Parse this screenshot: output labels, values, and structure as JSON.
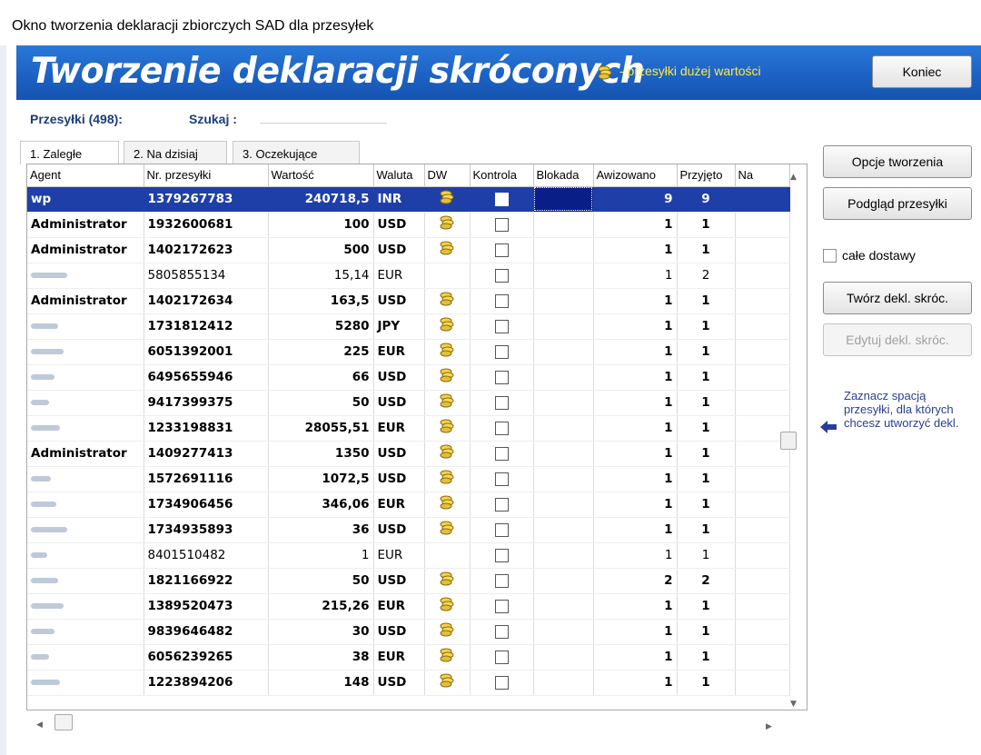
{
  "window": {
    "title": "Okno tworzenia deklaracji zbiorczych SAD dla przesyłek"
  },
  "banner": {
    "title": "Tworzenie deklaracji skróconych",
    "legend_icon": "coins-icon",
    "legend_text": "- przesyłki dużej wartości",
    "color": "#1c62c4",
    "legend_color": "#ffe94a"
  },
  "buttons": {
    "koniec": "Koniec",
    "opcje": "Opcje tworzenia",
    "podglad": "Podgląd przesyłki",
    "tworz": "Twórz dekl. skróc.",
    "edytuj": "Edytuj dekl. skróc."
  },
  "summary": {
    "count_label": "Przesyłki (498):",
    "search_label": "Szukaj :",
    "search_value": ""
  },
  "tabs": [
    {
      "label": "1. Zaległe",
      "active": true
    },
    {
      "label": "2. Na dzisiaj",
      "active": false
    },
    {
      "label": "3. Oczekujące",
      "active": false
    }
  ],
  "table": {
    "columns": [
      "Agent",
      "Nr. przesyłki",
      "Wartość",
      "Waluta",
      "DW",
      "Kontrola",
      "Blokada",
      "Awizowano",
      "Przyjęto",
      "Na"
    ],
    "rows": [
      {
        "agent": "wp",
        "nr": "1379267783",
        "wartosc": "240718,5",
        "waluta": "INR",
        "dw": true,
        "aw": "9",
        "prz": "9",
        "bold": true,
        "selected": true
      },
      {
        "agent": "Administrator",
        "nr": "1932600681",
        "wartosc": "100",
        "waluta": "USD",
        "dw": true,
        "aw": "1",
        "prz": "1",
        "bold": true
      },
      {
        "agent": "Administrator",
        "nr": "1402172623",
        "wartosc": "500",
        "waluta": "USD",
        "dw": true,
        "aw": "1",
        "prz": "1",
        "bold": true
      },
      {
        "agent": "",
        "nr": "5805855134",
        "wartosc": "15,14",
        "waluta": "EUR",
        "dw": false,
        "aw": "1",
        "prz": "2",
        "bold": false
      },
      {
        "agent": "Administrator",
        "nr": "1402172634",
        "wartosc": "163,5",
        "waluta": "USD",
        "dw": true,
        "aw": "1",
        "prz": "1",
        "bold": true
      },
      {
        "agent": "",
        "nr": "1731812412",
        "wartosc": "5280",
        "waluta": "JPY",
        "dw": true,
        "aw": "1",
        "prz": "1",
        "bold": true
      },
      {
        "agent": "",
        "nr": "6051392001",
        "wartosc": "225",
        "waluta": "EUR",
        "dw": true,
        "aw": "1",
        "prz": "1",
        "bold": true
      },
      {
        "agent": "",
        "nr": "6495655946",
        "wartosc": "66",
        "waluta": "USD",
        "dw": true,
        "aw": "1",
        "prz": "1",
        "bold": true
      },
      {
        "agent": "",
        "nr": "9417399375",
        "wartosc": "50",
        "waluta": "USD",
        "dw": true,
        "aw": "1",
        "prz": "1",
        "bold": true
      },
      {
        "agent": "",
        "nr": "1233198831",
        "wartosc": "28055,51",
        "waluta": "EUR",
        "dw": true,
        "aw": "1",
        "prz": "1",
        "bold": true
      },
      {
        "agent": "Administrator",
        "nr": "1409277413",
        "wartosc": "1350",
        "waluta": "USD",
        "dw": true,
        "aw": "1",
        "prz": "1",
        "bold": true
      },
      {
        "agent": "",
        "nr": "1572691116",
        "wartosc": "1072,5",
        "waluta": "USD",
        "dw": true,
        "aw": "1",
        "prz": "1",
        "bold": true
      },
      {
        "agent": "",
        "nr": "1734906456",
        "wartosc": "346,06",
        "waluta": "EUR",
        "dw": true,
        "aw": "1",
        "prz": "1",
        "bold": true
      },
      {
        "agent": "",
        "nr": "1734935893",
        "wartosc": "36",
        "waluta": "USD",
        "dw": true,
        "aw": "1",
        "prz": "1",
        "bold": true
      },
      {
        "agent": "",
        "nr": "8401510482",
        "wartosc": "1",
        "waluta": "EUR",
        "dw": false,
        "aw": "1",
        "prz": "1",
        "bold": false
      },
      {
        "agent": "",
        "nr": "1821166922",
        "wartosc": "50",
        "waluta": "USD",
        "dw": true,
        "aw": "2",
        "prz": "2",
        "bold": true
      },
      {
        "agent": "",
        "nr": "1389520473",
        "wartosc": "215,26",
        "waluta": "EUR",
        "dw": true,
        "aw": "1",
        "prz": "1",
        "bold": true
      },
      {
        "agent": "",
        "nr": "9839646482",
        "wartosc": "30",
        "waluta": "USD",
        "dw": true,
        "aw": "1",
        "prz": "1",
        "bold": true
      },
      {
        "agent": "",
        "nr": "6056239265",
        "wartosc": "38",
        "waluta": "EUR",
        "dw": true,
        "aw": "1",
        "prz": "1",
        "bold": true
      },
      {
        "agent": "",
        "nr": "1223894206",
        "wartosc": "148",
        "waluta": "USD",
        "dw": true,
        "aw": "1",
        "prz": "1",
        "bold": true
      }
    ]
  },
  "options": {
    "cale_dostawy": "całe dostawy"
  },
  "hint": {
    "text": "Zaznacz spacją przesyłki, dla których chcesz utworzyć dekl."
  }
}
